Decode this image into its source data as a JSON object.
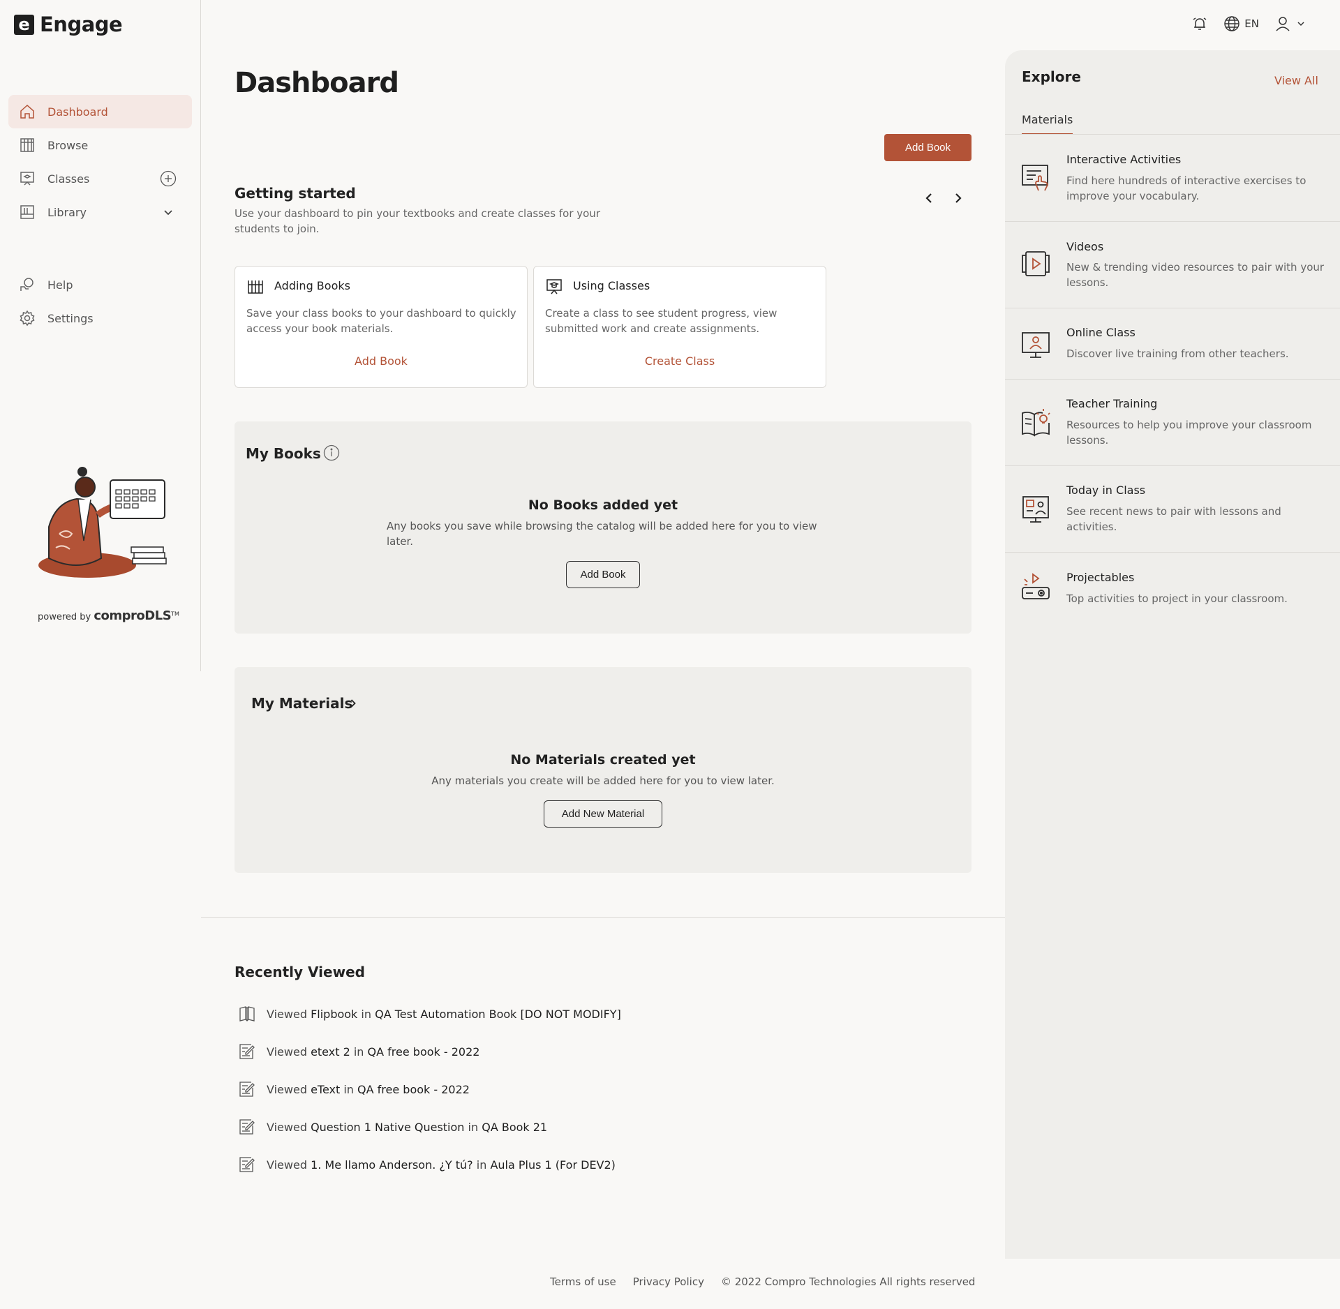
{
  "app": {
    "logo_letter": "e",
    "name": "Engage"
  },
  "sidebar": {
    "items": [
      {
        "label": "Dashboard",
        "icon": "home-icon",
        "active": true
      },
      {
        "label": "Browse",
        "icon": "books-icon"
      },
      {
        "label": "Classes",
        "icon": "classroom-icon"
      },
      {
        "label": "Library",
        "icon": "library-icon"
      }
    ],
    "secondary": [
      {
        "label": "Help",
        "icon": "help-icon"
      },
      {
        "label": "Settings",
        "icon": "gear-icon"
      }
    ],
    "powered_prefix": "powered by",
    "powered_brand": "comproDLS",
    "powered_tm": "TM"
  },
  "topbar": {
    "language": "EN"
  },
  "main": {
    "title": "Dashboard",
    "add_book_label": "Add Book",
    "getting_started": {
      "title": "Getting started",
      "description": "Use your dashboard to pin your textbooks and create classes for your students to join.",
      "cards": [
        {
          "title": "Adding Books",
          "description": "Save your class books to your dashboard to quickly access your book materials.",
          "link": "Add Book"
        },
        {
          "title": "Using Classes",
          "description": "Create a class to see student progress, view submitted work and create assignments.",
          "link": "Create Class"
        }
      ]
    },
    "my_books": {
      "title": "My Books",
      "empty_title": "No Books added yet",
      "empty_desc": "Any books you save while browsing the catalog will be added here for you to view later.",
      "button": "Add Book"
    },
    "my_materials": {
      "title": "My Materials",
      "empty_title": "No Materials created yet",
      "empty_desc": "Any materials you create will be added here for you to view later.",
      "button": "Add New Material"
    },
    "recently_viewed": {
      "title": "Recently Viewed",
      "items": [
        {
          "icon": "flipbook-icon",
          "prefix": "Viewed",
          "item": "Flipbook",
          "in": "in",
          "book": "QA Test Automation Book [DO NOT MODIFY]"
        },
        {
          "icon": "etext-icon",
          "prefix": "Viewed",
          "item": "etext 2",
          "in": "in",
          "book": "QA free book - 2022"
        },
        {
          "icon": "etext-icon",
          "prefix": "Viewed",
          "item": "eText",
          "in": "in",
          "book": "QA free book - 2022"
        },
        {
          "icon": "etext-icon",
          "prefix": "Viewed",
          "item": "Question 1 Native Question",
          "in": "in",
          "book": "QA Book 21"
        },
        {
          "icon": "etext-icon",
          "prefix": "Viewed",
          "item": "1. Me llamo Anderson. ¿Y tú?",
          "in": "in",
          "book": "Aula Plus 1 (For DEV2)"
        }
      ]
    }
  },
  "footer": {
    "terms": "Terms of use",
    "privacy": "Privacy Policy",
    "copyright": "© 2022 Compro Technologies All rights reserved"
  },
  "explore": {
    "title": "Explore",
    "view_all": "View All",
    "tab": "Materials",
    "items": [
      {
        "title": "Interactive Activities",
        "description": "Find here hundreds of interactive exercises to improve your vocabulary.",
        "icon": "interactive-activities-icon"
      },
      {
        "title": "Videos",
        "description": "New & trending video resources to pair with your lessons.",
        "icon": "video-icon"
      },
      {
        "title": "Online Class",
        "description": "Discover live training from other teachers.",
        "icon": "online-class-icon"
      },
      {
        "title": "Teacher Training",
        "description": "Resources to help you improve your classroom lessons.",
        "icon": "teacher-training-icon"
      },
      {
        "title": "Today in Class",
        "description": "See recent news to pair with lessons and activities.",
        "icon": "today-in-class-icon"
      },
      {
        "title": "Projectables",
        "description": "Top activities to project in your classroom.",
        "icon": "projector-icon"
      }
    ]
  },
  "colors": {
    "accent": "#b35337",
    "active_bg": "#f5e8e4",
    "panel": "#efeeeb",
    "background": "#f9f8f6"
  }
}
